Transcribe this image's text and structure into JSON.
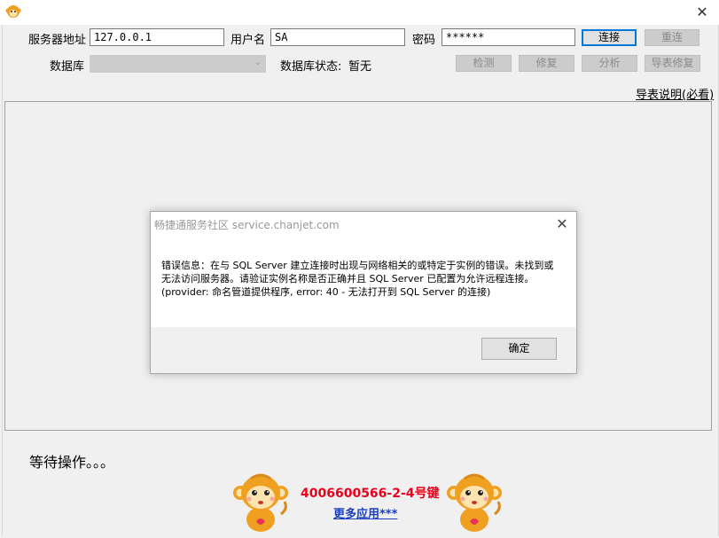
{
  "window": {
    "close_glyph": "✕"
  },
  "form": {
    "server_label": "服务器地址",
    "server_value": "127.0.0.1",
    "user_label": "用户名",
    "user_value": "SA",
    "password_label": "密码",
    "password_value": "******",
    "connect_button": "连接",
    "reconnect_button": "重连",
    "database_label": "数据库",
    "database_value": "",
    "db_status_label": "数据库状态:",
    "db_status_value": "暂无",
    "detect_button": "检测",
    "repair_button": "修复",
    "analyze_button": "分析",
    "table_repair_button": "导表修复",
    "guide_link": "导表说明(必看)"
  },
  "status": {
    "text": "等待操作。。。"
  },
  "promo": {
    "hotline": "4006600566-2-4号键",
    "more_apps": "更多应用***"
  },
  "dialog": {
    "title": "畅捷通服务社区 service.chanjet.com",
    "close_glyph": "✕",
    "message": "错误信息：在与 SQL Server 建立连接时出现与网络相关的或特定于实例的错误。未找到或无法访问服务器。请验证实例名称是否正确并且 SQL Server 已配置为允许远程连接。(provider: 命名管道提供程序, error: 40 - 无法打开到 SQL Server 的连接)",
    "ok_button": "确定"
  },
  "colors": {
    "hotline": "#e8001c",
    "link_blue": "#1a3fbf",
    "primary_border": "#0078d7"
  },
  "icons": [
    "monkey-app-icon",
    "close-icon",
    "dropdown-arrow-icon",
    "monkey-mascot-icon"
  ]
}
